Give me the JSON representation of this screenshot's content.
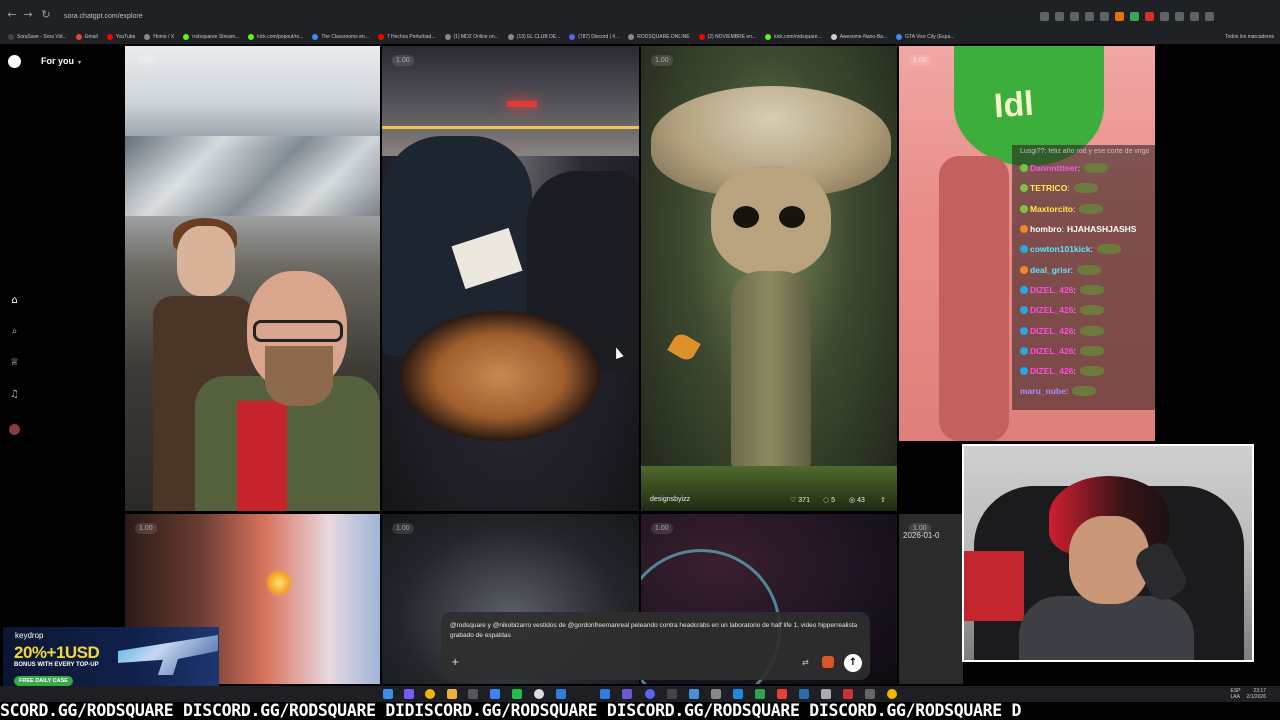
{
  "browser": {
    "url": "sora.chatgpt.com/explore",
    "bookmarks": [
      {
        "label": "SoraSave - Sora Vid...",
        "color": "#444"
      },
      {
        "label": "Gmail",
        "color": "#ea4335"
      },
      {
        "label": "YouTube",
        "color": "#ff0000"
      },
      {
        "label": "Home / X",
        "color": "#888"
      },
      {
        "label": "rodsquaree Stream...",
        "color": "#53fc18"
      },
      {
        "label": "kick.com/popout/ro...",
        "color": "#53fc18"
      },
      {
        "label": "The Classrooms en...",
        "color": "#4285f4"
      },
      {
        "label": "7 Hechos Perturbad...",
        "color": "#ff0000"
      },
      {
        "label": "(1) MDZ Online on...",
        "color": "#888"
      },
      {
        "label": "(13) EL CLUB DE...",
        "color": "#888"
      },
      {
        "label": "(787) Discord | #...",
        "color": "#5865f2"
      },
      {
        "label": "RODSQUARE.ONLINE",
        "color": "#888"
      },
      {
        "label": "(2) NOVIEMBRE en...",
        "color": "#ff0000"
      },
      {
        "label": "kick.com/rodsquare...",
        "color": "#53fc18"
      },
      {
        "label": "Awesome-Nano-Ba...",
        "color": "#ccc"
      },
      {
        "label": "GTA Vice City (Espa...",
        "color": "#4285f4"
      }
    ],
    "all_bookmarks": "Todos los marcadores"
  },
  "sidebar": {
    "feed_label": "For you",
    "icons": [
      "home-icon",
      "search-icon",
      "trophy-icon",
      "bell-icon"
    ]
  },
  "tiles": [
    {
      "badge": "1.00"
    },
    {
      "badge": "1.00"
    },
    {
      "badge": "1.00",
      "author": "designsbyizz",
      "likes": "371",
      "comments": "5",
      "remixes": "43"
    },
    {
      "badge": "1.00"
    },
    {
      "badge": "1.00"
    },
    {
      "badge": "1.00"
    },
    {
      "badge": "1.00"
    },
    {
      "badge": "1.00",
      "date": "2026-01-0"
    }
  ],
  "chat": {
    "top_line": "Lusgi??: feliz año rod y ese corte de virgo.",
    "messages": [
      {
        "user": "Dannnttteer",
        "color": "#f25ce3",
        "emote": true,
        "text": "",
        "badge_color": "#7cc242"
      },
      {
        "user": "TETRICO",
        "color": "#ffe94d",
        "emote": true,
        "text": "",
        "badge_color": "#7cc242"
      },
      {
        "user": "Maxtorcito",
        "color": "#ffe94d",
        "emote": true,
        "text": "",
        "badge_color": "#7cc242"
      },
      {
        "user": "hombro",
        "color": "#ffffff",
        "emote": false,
        "text": "HJAHASHJASHS",
        "badge_color": "#f08a24"
      },
      {
        "user": "cowton101kick",
        "color": "#67e0ff",
        "emote": true,
        "text": "",
        "badge_color": "#29a8e0"
      },
      {
        "user": "deal_grisr",
        "color": "#67e0ff",
        "emote": true,
        "text": "",
        "badge_color": "#f08a24"
      },
      {
        "user": "DIZEL_426",
        "color": "#ff4fd8",
        "emote": true,
        "text": "",
        "badge_color": "#29a8e0"
      },
      {
        "user": "DIZEL_426",
        "color": "#ff4fd8",
        "emote": true,
        "text": "",
        "badge_color": "#29a8e0"
      },
      {
        "user": "DIZEL_426",
        "color": "#ff4fd8",
        "emote": true,
        "text": "",
        "badge_color": "#29a8e0"
      },
      {
        "user": "DIZEL_426",
        "color": "#ff4fd8",
        "emote": true,
        "text": "",
        "badge_color": "#29a8e0"
      },
      {
        "user": "DIZEL_426",
        "color": "#ff4fd8",
        "emote": true,
        "text": "",
        "badge_color": "#29a8e0"
      },
      {
        "user": "maru_nube",
        "color": "#a98cff",
        "emote": true,
        "text": "",
        "badge_color": ""
      }
    ]
  },
  "composer": {
    "prompt": "@rodsquare y @nikobizarro vestidos de @gordonfreemanreal peleando contra headcrabs en un laboratorio de half life 1, video hipperrealista grabado de espaldas",
    "plus": "+",
    "send": "↑"
  },
  "ad": {
    "brand": "keydrop",
    "bonus": "20%+1USD",
    "sub": "BONUS WITH EVERY TOP-UP",
    "cta": "FREE DAILY CASE"
  },
  "taskbar": {
    "lang": "ESP",
    "lang2": "LAA",
    "time": "23:17",
    "date": "2/1/2026"
  },
  "ticker": "SCORD.GG/RODSQUARE DISCORD.GG/RODSQUARE DIDISCORD.GG/RODSQUARE DISCORD.GG/RODSQUARE DISCORD.GG/RODSQUARE D",
  "colors": {
    "background": "#000000",
    "accent": "#ffffff"
  }
}
